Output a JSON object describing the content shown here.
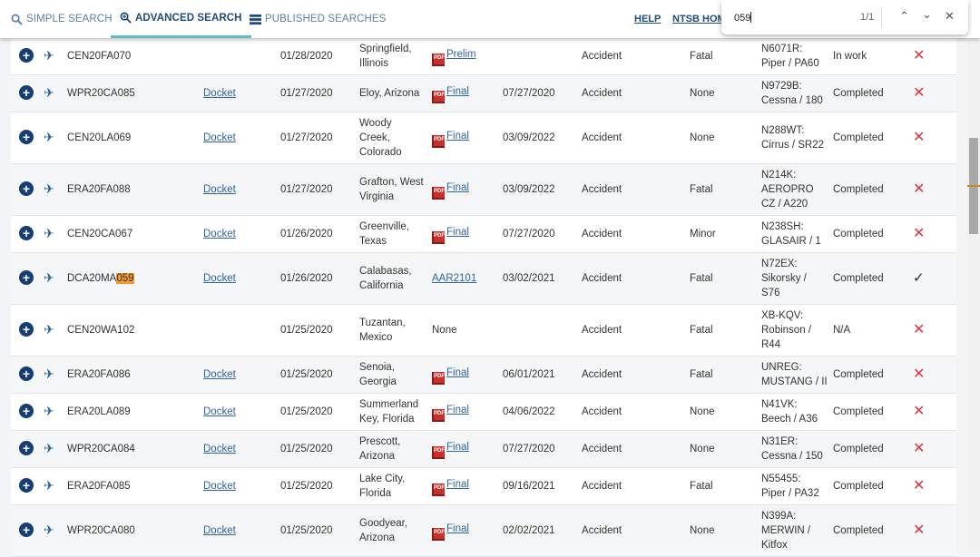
{
  "nav": {
    "tabs": [
      {
        "label": "SIMPLE SEARCH",
        "icon": "search-icon"
      },
      {
        "label": "ADVANCED SEARCH",
        "icon": "zoom-in-icon"
      },
      {
        "label": "PUBLISHED SEARCHES",
        "icon": "list-icon"
      }
    ],
    "help": "HELP",
    "home": "NTSB HOM"
  },
  "find": {
    "query": "059",
    "count": "1/1"
  },
  "rows": [
    {
      "id": "CEN20FA070",
      "docket": "",
      "date": "01/28/2020",
      "loc": "Springfield, Illinois",
      "report": "Prelim",
      "pdf": true,
      "rdate": "",
      "event": "Accident",
      "injury": "Fatal",
      "aircraft": "N6071R: Piper / PA60",
      "status": "In work",
      "mark": "x"
    },
    {
      "id": "WPR20CA085",
      "docket": "Docket",
      "date": "01/27/2020",
      "loc": "Eloy, Arizona",
      "report": "Final",
      "pdf": true,
      "rdate": "07/27/2020",
      "event": "Accident",
      "injury": "None",
      "aircraft": "N9729B: Cessna / 180",
      "status": "Completed",
      "mark": "x"
    },
    {
      "id": "CEN20LA069",
      "docket": "Docket",
      "date": "01/27/2020",
      "loc": "Woody Creek, Colorado",
      "report": "Final",
      "pdf": true,
      "rdate": "03/09/2022",
      "event": "Accident",
      "injury": "None",
      "aircraft": "N288WT: Cirrus / SR22",
      "status": "Completed",
      "mark": "x"
    },
    {
      "id": "ERA20FA088",
      "docket": "Docket",
      "date": "01/27/2020",
      "loc": "Grafton, West Virginia",
      "report": "Final",
      "pdf": true,
      "rdate": "03/09/2022",
      "event": "Accident",
      "injury": "Fatal",
      "aircraft": "N214K: AEROPRO CZ / A220",
      "status": "Completed",
      "mark": "x"
    },
    {
      "id": "CEN20CA067",
      "docket": "Docket",
      "date": "01/26/2020",
      "loc": "Greenville, Texas",
      "report": "Final",
      "pdf": true,
      "rdate": "07/27/2020",
      "event": "Accident",
      "injury": "Minor",
      "aircraft": "N238SH: GLASAIR / 1",
      "status": "Completed",
      "mark": "x"
    },
    {
      "id": "DCA20MA",
      "hl": "059",
      "docket": "Docket",
      "date": "01/26/2020",
      "loc": "Calabasas, California",
      "report": "AAR2101",
      "pdf": false,
      "rdate": "03/02/2021",
      "event": "Accident",
      "injury": "Fatal",
      "aircraft": "N72EX: Sikorsky / S76",
      "status": "Completed",
      "mark": "check"
    },
    {
      "id": "CEN20WA102",
      "docket": "",
      "date": "01/25/2020",
      "loc": "Tuzantan, Mexico",
      "report": "None",
      "plain": true,
      "pdf": false,
      "rdate": "",
      "event": "Accident",
      "injury": "Fatal",
      "aircraft": "XB-KQV: Robinson / R44",
      "status": "N/A",
      "mark": "x"
    },
    {
      "id": "ERA20FA086",
      "docket": "Docket",
      "date": "01/25/2020",
      "loc": "Senoia, Georgia",
      "report": "Final",
      "pdf": true,
      "rdate": "06/01/2021",
      "event": "Accident",
      "injury": "Fatal",
      "aircraft": "UNREG: MUSTANG / II",
      "status": "Completed",
      "mark": "x"
    },
    {
      "id": "ERA20LA089",
      "docket": "Docket",
      "date": "01/25/2020",
      "loc": "Summerland Key, Florida",
      "report": "Final",
      "pdf": true,
      "rdate": "04/06/2022",
      "event": "Accident",
      "injury": "None",
      "aircraft": "N41VK: Beech / A36",
      "status": "Completed",
      "mark": "x"
    },
    {
      "id": "WPR20CA084",
      "docket": "Docket",
      "date": "01/25/2020",
      "loc": "Prescott, Arizona",
      "report": "Final",
      "pdf": true,
      "rdate": "07/27/2020",
      "event": "Accident",
      "injury": "None",
      "aircraft": "N31ER: Cessna / 150",
      "status": "Completed",
      "mark": "x"
    },
    {
      "id": "ERA20FA085",
      "docket": "Docket",
      "date": "01/25/2020",
      "loc": "Lake City, Florida",
      "report": "Final",
      "pdf": true,
      "rdate": "09/16/2021",
      "event": "Accident",
      "injury": "Fatal",
      "aircraft": "N55455: Piper / PA32",
      "status": "Completed",
      "mark": "x"
    },
    {
      "id": "WPR20CA080",
      "docket": "Docket",
      "date": "01/25/2020",
      "loc": "Goodyear, Arizona",
      "report": "Final",
      "pdf": true,
      "rdate": "02/02/2021",
      "event": "Accident",
      "injury": "None",
      "aircraft": "N399A: MERWIN / Kitfox",
      "status": "Completed",
      "mark": "x"
    }
  ]
}
